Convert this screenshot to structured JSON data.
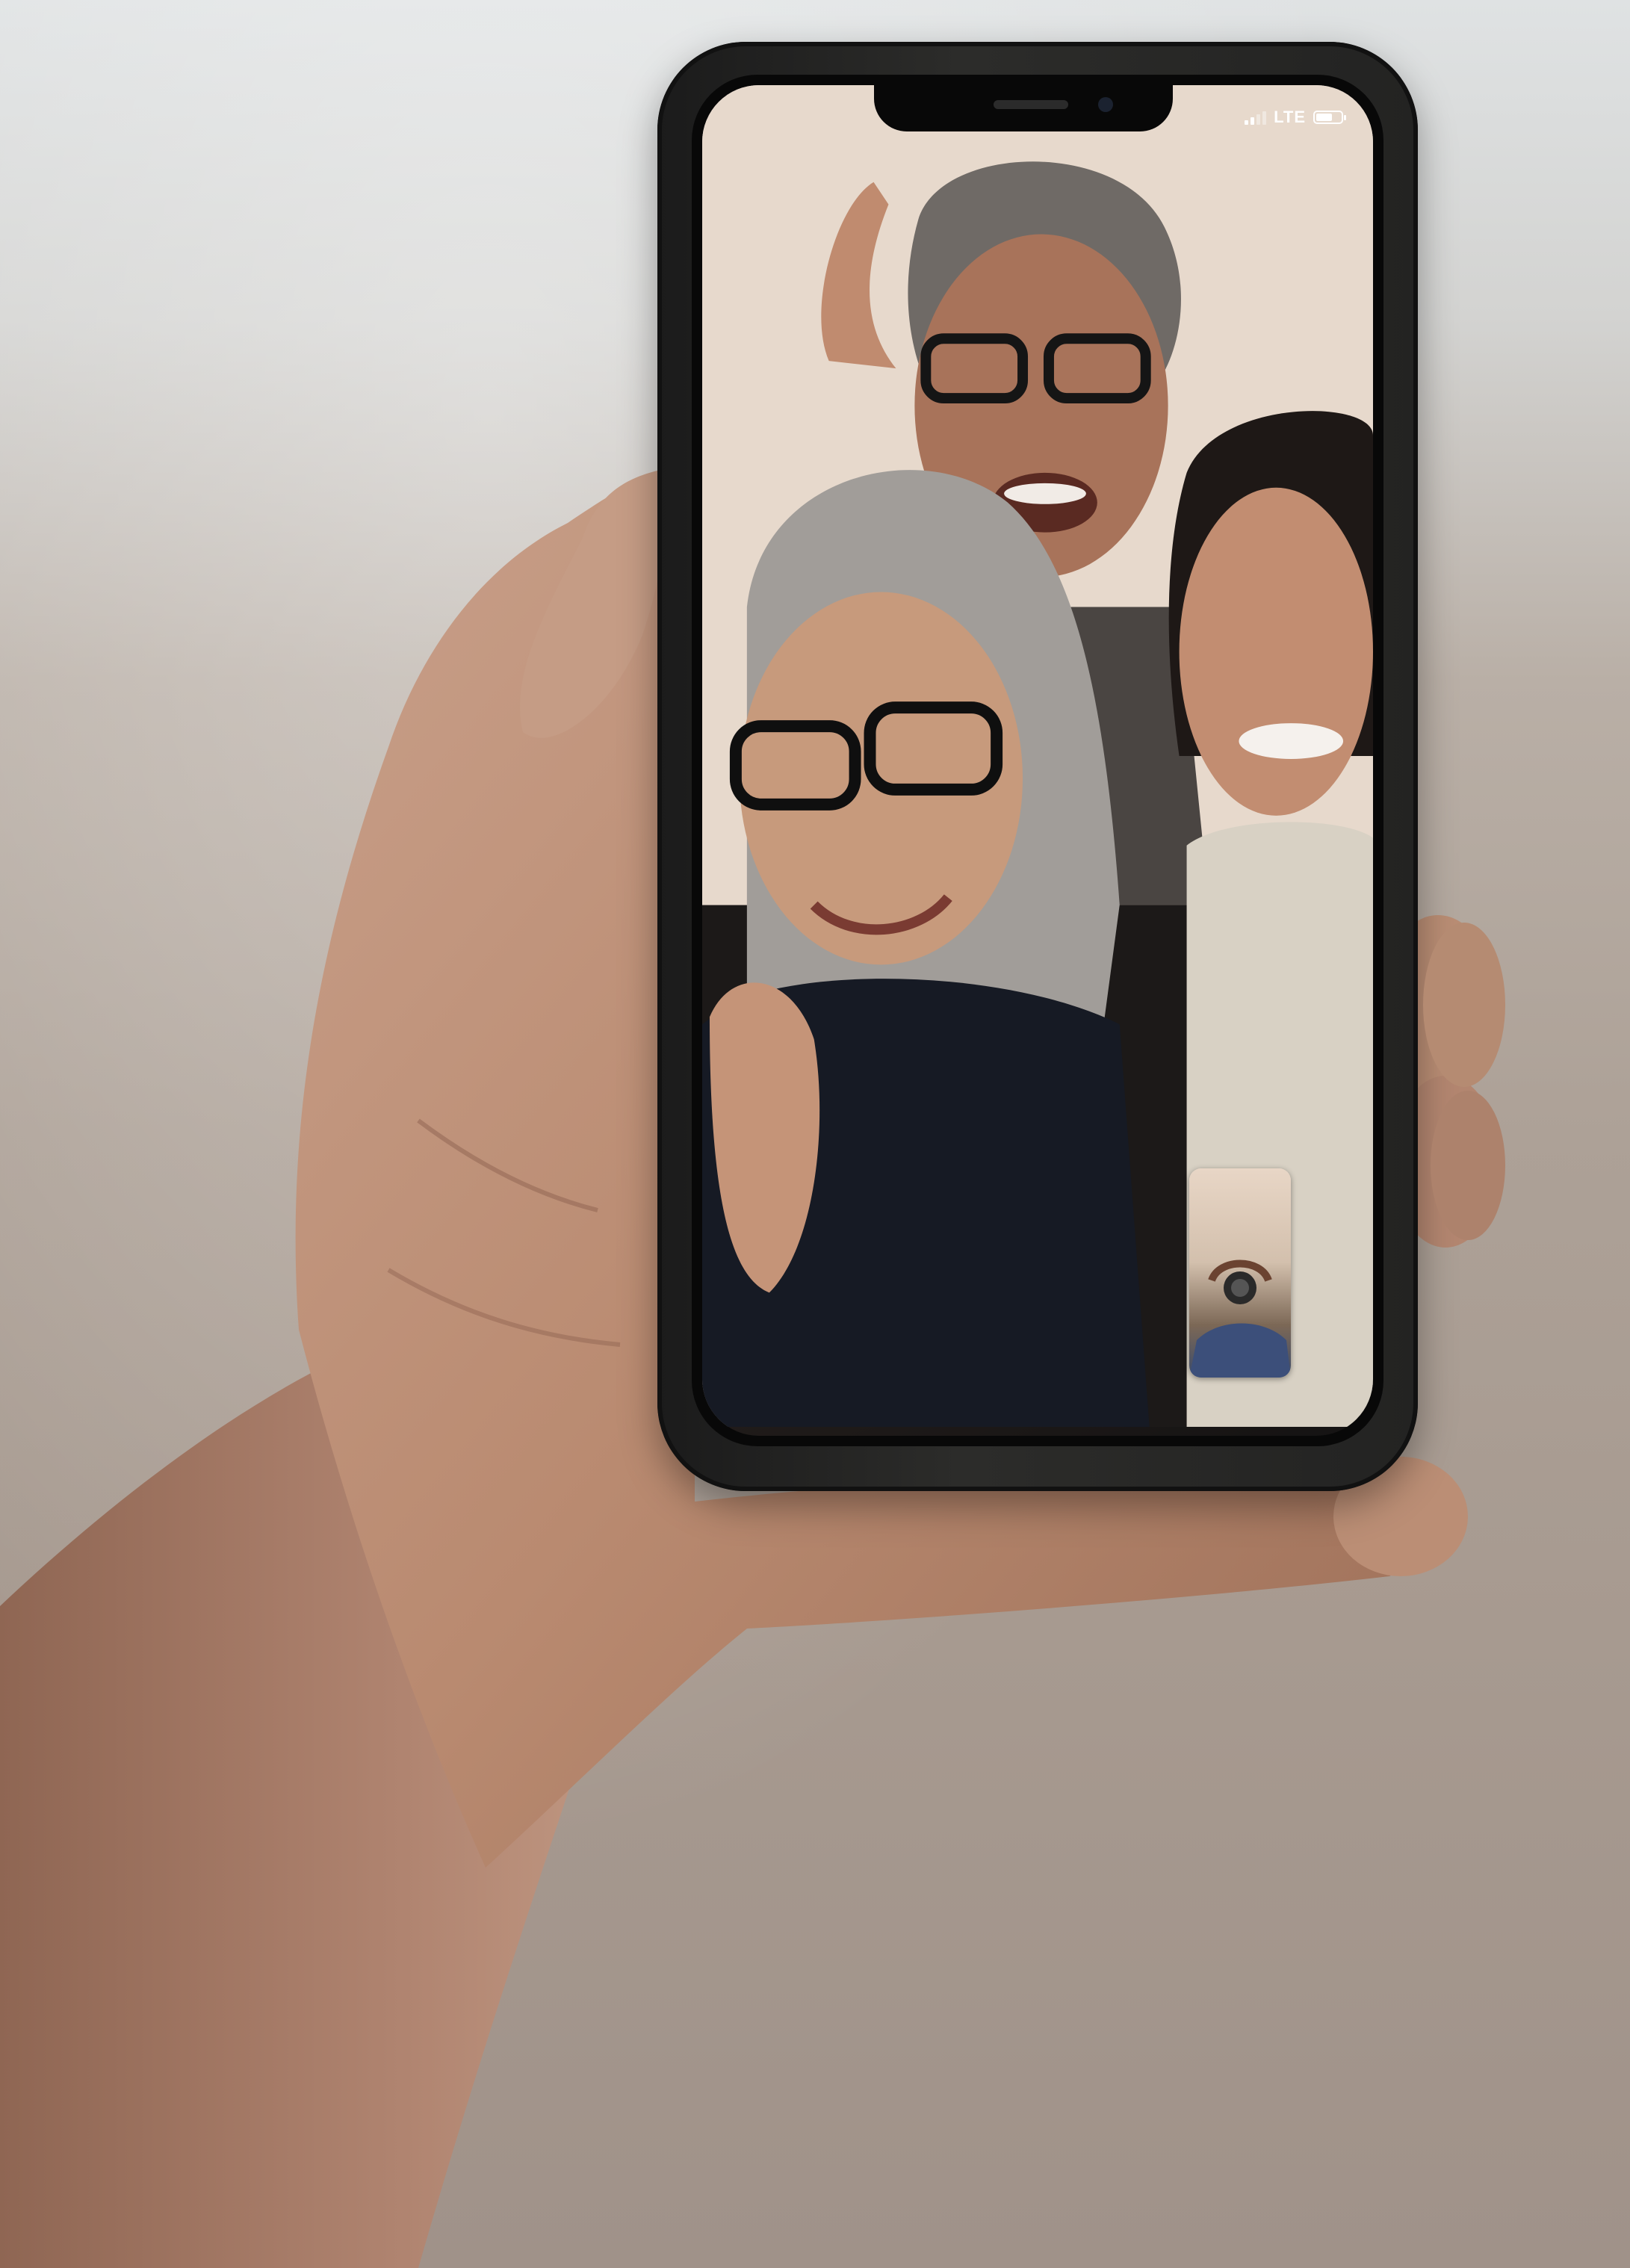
{
  "status_bar": {
    "network": "LTE",
    "signal_bars": 2,
    "signal_bars_total": 4,
    "battery_level": 0.65,
    "icons": [
      "signal-icon",
      "battery-icon"
    ]
  },
  "video_call": {
    "remote_participants": 3,
    "self_view": true
  },
  "colors": {
    "background_top": "#dfe2e3",
    "background_bottom": "#a09289",
    "phone_case": "#232322",
    "skin": "#c79a7c"
  }
}
